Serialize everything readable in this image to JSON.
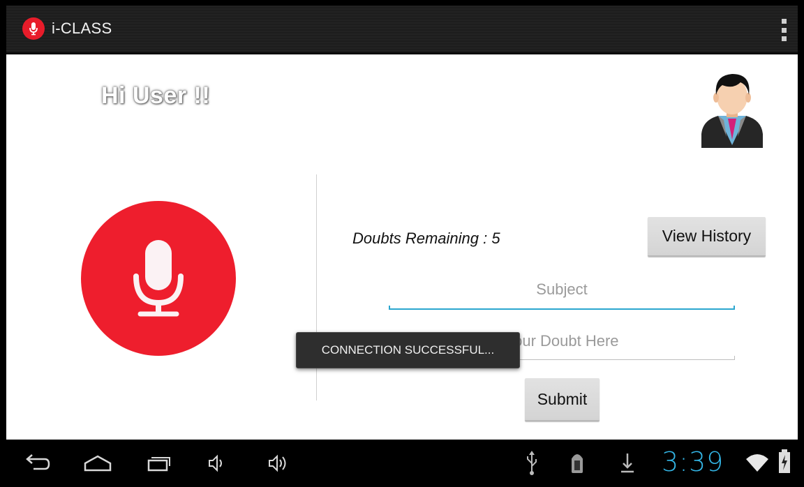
{
  "app": {
    "title": "i-CLASS"
  },
  "main": {
    "greeting": "Hi User !!",
    "doubts_remaining": "Doubts Remaining : 5",
    "view_history_label": "View History",
    "subject_placeholder": "Subject",
    "doubt_placeholder": "Your Doubt Here",
    "submit_label": "Submit"
  },
  "toast": {
    "message": "CONNECTION SUCCESSFUL..."
  },
  "status_bar": {
    "time": "3:39"
  },
  "icons": {
    "app": "microphone-icon",
    "overflow": "overflow-menu-icon",
    "mic": "microphone-icon",
    "avatar": "user-avatar-icon",
    "nav": [
      "back-icon",
      "home-icon",
      "recent-apps-icon",
      "volume-down-icon",
      "volume-up-icon"
    ],
    "status": [
      "usb-icon",
      "android-debug-icon",
      "download-icon",
      "wifi-icon",
      "battery-charging-icon"
    ]
  },
  "colors": {
    "accent_red": "#ee1e2d",
    "focus_blue": "#2ba6cf",
    "clock_blue": "#33b5e5"
  }
}
